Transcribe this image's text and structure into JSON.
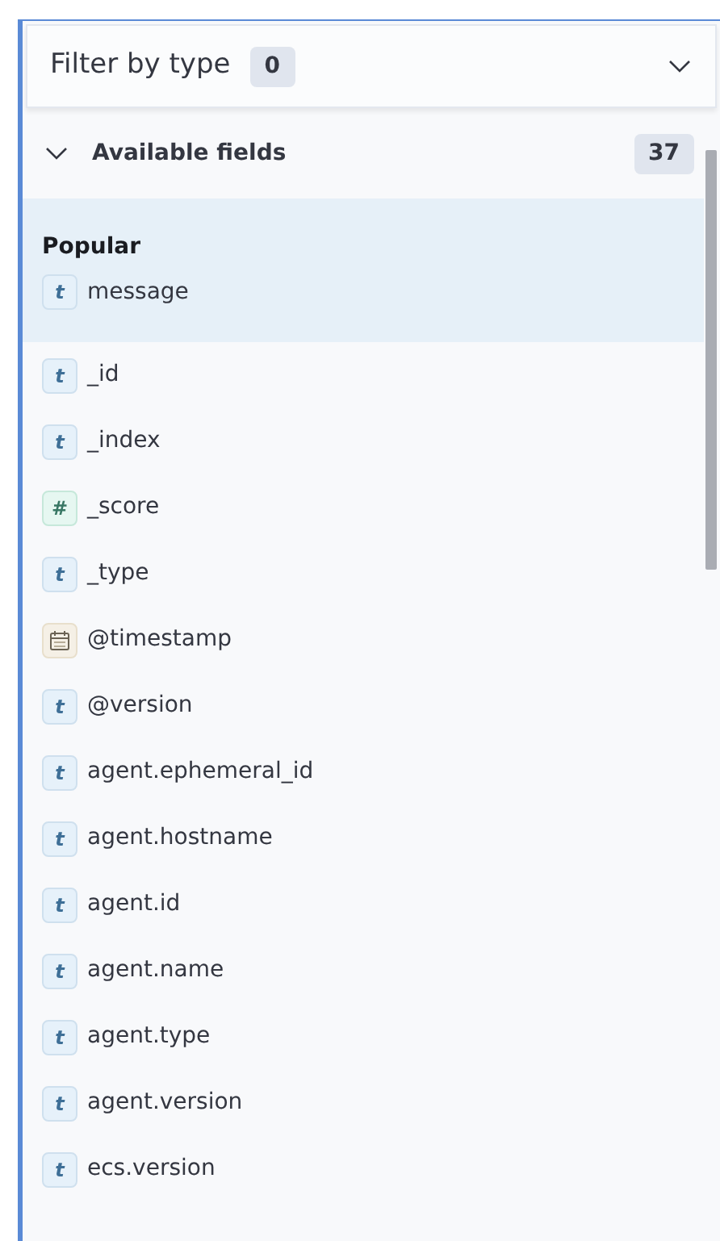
{
  "filter": {
    "label": "Filter by type",
    "count": "0"
  },
  "available": {
    "title": "Available fields",
    "count": "37",
    "expanded": true
  },
  "popular": {
    "title": "Popular",
    "fields": [
      {
        "kind": "string",
        "token": "t",
        "name": "message"
      }
    ]
  },
  "fields": [
    {
      "kind": "string",
      "token": "t",
      "name": "_id"
    },
    {
      "kind": "string",
      "token": "t",
      "name": "_index"
    },
    {
      "kind": "number",
      "token": "#",
      "name": "_score"
    },
    {
      "kind": "string",
      "token": "t",
      "name": "_type"
    },
    {
      "kind": "date",
      "name": "@timestamp"
    },
    {
      "kind": "string",
      "token": "t",
      "name": "@version"
    },
    {
      "kind": "string",
      "token": "t",
      "name": "agent.ephemeral_id"
    },
    {
      "kind": "string",
      "token": "t",
      "name": "agent.hostname"
    },
    {
      "kind": "string",
      "token": "t",
      "name": "agent.id"
    },
    {
      "kind": "string",
      "token": "t",
      "name": "agent.name"
    },
    {
      "kind": "string",
      "token": "t",
      "name": "agent.type"
    },
    {
      "kind": "string",
      "token": "t",
      "name": "agent.version"
    },
    {
      "kind": "string",
      "token": "t",
      "name": "ecs.version"
    }
  ]
}
